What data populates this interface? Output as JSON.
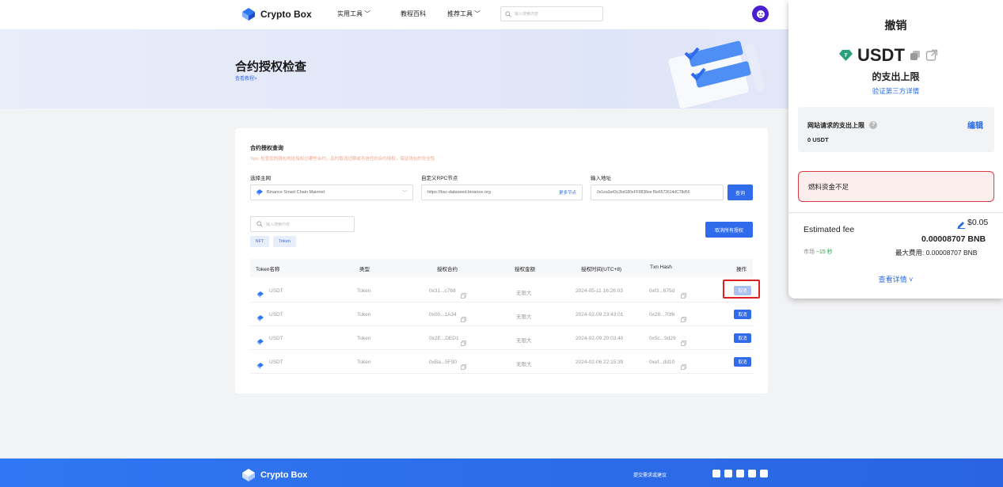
{
  "header": {
    "brand": "Crypto Box",
    "nav": [
      {
        "label": "实用工具",
        "has_dropdown": true
      },
      {
        "label": "教程百科",
        "has_dropdown": false
      },
      {
        "label": "推荐工具",
        "has_dropdown": true
      }
    ],
    "search_placeholder": "输入搜索内容"
  },
  "banner": {
    "title": "合约授权检查",
    "link": "查看教程>"
  },
  "card": {
    "title": "合约授权查询",
    "tips": "Tips: 检查您的钱包地址授权过哪些合约，及时取消过期或不信任的合约授权，保证钱包的安全性",
    "network_label": "选择主网",
    "network_value": "Binance Smart Chain Mainnet",
    "rpc_label": "自定义RPC节点",
    "rpc_value": "https://bsc-dataseed.binance.org",
    "rpc_more": "更多节点",
    "address_label": "输入地址",
    "address_value": "0x1ea3a43c2bd180eFF8838ee f9e6573614dC78d56",
    "query_button": "查询",
    "filter_placeholder": "输入搜索内容",
    "tags": [
      "NFT",
      "Token"
    ],
    "cancel_all_button": "取消所有授权",
    "columns": [
      "Token名称",
      "类型",
      "授权合约",
      "授权金额",
      "授权时间(UTC+8)",
      "Txn Hash",
      "操作"
    ],
    "rows": [
      {
        "token": "USDT",
        "type": "Token",
        "contract": "0x31...c768",
        "amount": "无限大",
        "time": "2024-05-11 16:26:03",
        "hash": "0xf3...675d",
        "action": "取消",
        "active": true
      },
      {
        "token": "USDT",
        "type": "Token",
        "contract": "0x00...1A34",
        "amount": "无限大",
        "time": "2024-02-09 23:43:01",
        "hash": "0x28...70f6",
        "action": "取消",
        "active": false
      },
      {
        "token": "USDT",
        "type": "Token",
        "contract": "0x2E...DED1",
        "amount": "无限大",
        "time": "2024-02-09 20:03:40",
        "hash": "0x5c...9d29",
        "action": "取消",
        "active": false
      },
      {
        "token": "USDT",
        "type": "Token",
        "contract": "0xBa...5F90",
        "amount": "无限大",
        "time": "2024-02-06 22:15:39",
        "hash": "0xef...dd10",
        "action": "取消",
        "active": false
      }
    ]
  },
  "footer": {
    "brand": "Crypto Box",
    "link": "提交需求或建议"
  },
  "wallet": {
    "title": "撤销",
    "token": "USDT",
    "subtitle": "的支出上限",
    "verify_link": "验证第三方详情",
    "limit_label": "网站请求的支出上限",
    "limit_value": "0 USDT",
    "edit": "编辑",
    "alert": "燃料资金不足",
    "fee_label": "Estimated fee",
    "fee_usd": "$0.05",
    "fee_bnb": "0.00008707 BNB",
    "market_label": "市场",
    "market_time": "~15 秒",
    "max_fee": "最大费用: 0.00008707 BNB",
    "details": "查看详情"
  },
  "colors": {
    "accent": "#2f6bea",
    "danger": "#d73a49",
    "footer": "#2f77f2"
  }
}
